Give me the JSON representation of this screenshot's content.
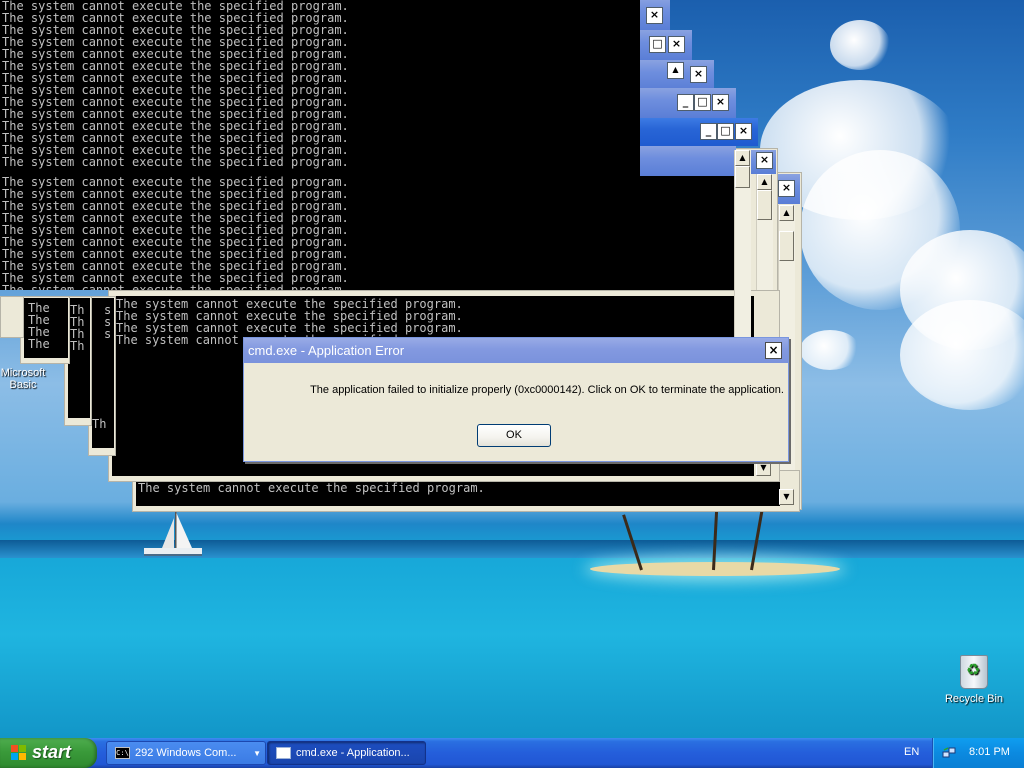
{
  "console": {
    "error_line": "The system cannot execute the specified program.",
    "stub_the": "The",
    "stub_th": "Th",
    "stub_s": "s"
  },
  "dialog": {
    "title": "cmd.exe - Application Error",
    "message": "The application failed to initialize properly (0xc0000142). Click on OK to terminate the application.",
    "ok_label": "OK",
    "close_glyph": "×"
  },
  "desktop": {
    "recycle_bin_label": "Recycle Bin",
    "ms_basic_label_1": "Microsoft",
    "ms_basic_label_2": "Basic"
  },
  "taskbar": {
    "start_label": "start",
    "task1_label": "292 Windows Com...",
    "task2_label": "cmd.exe - Application...",
    "language": "EN",
    "clock": "8:01 PM"
  },
  "caption": {
    "minimize": "_",
    "maximize": "□",
    "close": "×"
  },
  "icons": [
    "start-logo-icon",
    "cmd-icon",
    "window-icon",
    "recycle-bin-icon",
    "network-icon",
    "close-icon",
    "minimize-icon",
    "maximize-icon",
    "scroll-up-icon",
    "scroll-down-icon"
  ]
}
